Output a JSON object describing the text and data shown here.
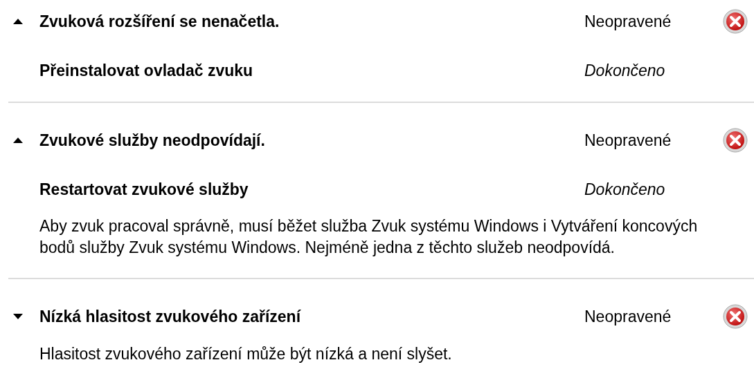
{
  "issues": [
    {
      "title": "Zvuková rozšíření se nenačetla.",
      "expanded": true,
      "status": "Neopravené",
      "actions": [
        {
          "label": "Přeinstalovat ovladač zvuku",
          "status": "Dokončeno"
        }
      ]
    },
    {
      "title": "Zvukové služby neodpovídají.",
      "expanded": true,
      "status": "Neopravené",
      "actions": [
        {
          "label": "Restartovat zvukové služby",
          "status": "Dokončeno"
        }
      ],
      "description": "Aby zvuk pracoval správně, musí běžet služba Zvuk systému Windows i Vytváření koncových bodů služby Zvuk systému Windows. Nejméně jedna z těchto služeb neodpovídá."
    },
    {
      "title": "Nízká hlasitost zvukového zařízení",
      "expanded": false,
      "status": "Neopravené",
      "description": "Hlasitost zvukového zařízení může být nízká a není slyšet."
    }
  ]
}
